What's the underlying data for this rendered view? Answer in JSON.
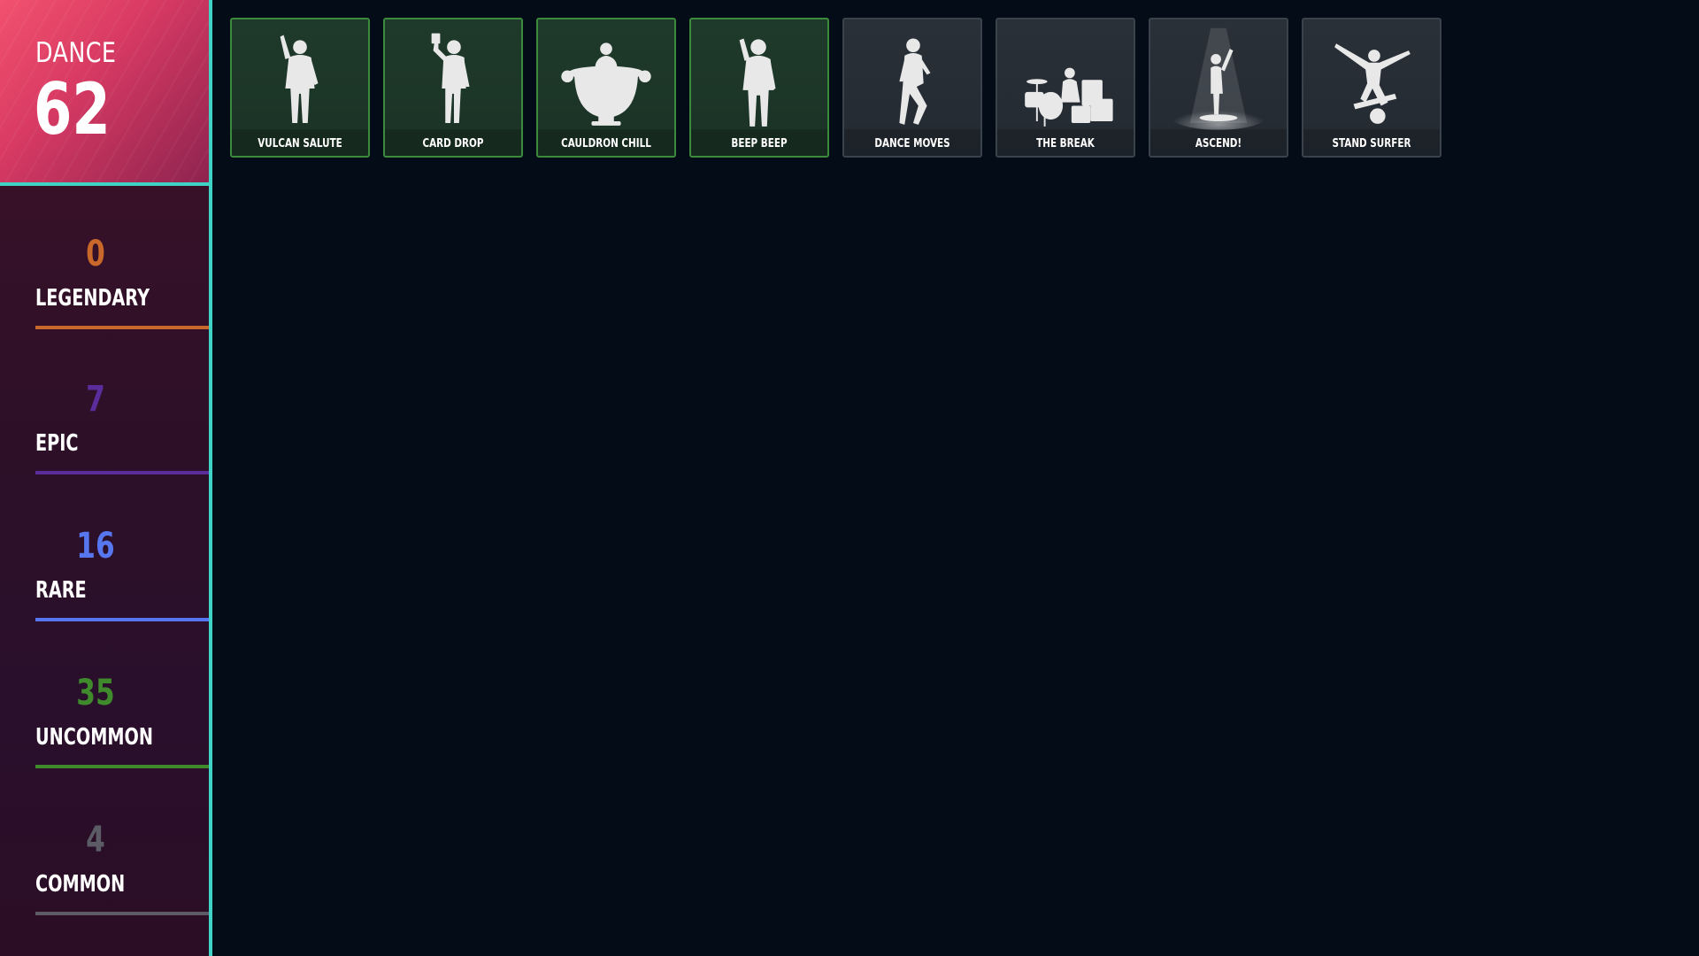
{
  "locker": {
    "category_label": "DANCE",
    "total_count": "62"
  },
  "rarities": [
    {
      "count": "0",
      "label": "LEGENDARY",
      "color": "#c8682a"
    },
    {
      "count": "7",
      "label": "EPIC",
      "color": "#5b2d9c"
    },
    {
      "count": "16",
      "label": "RARE",
      "color": "#5677f0"
    },
    {
      "count": "35",
      "label": "UNCOMMON",
      "color": "#3f8b2c"
    },
    {
      "count": "4",
      "label": "COMMON",
      "color": "#5c5c66"
    }
  ],
  "emotes": [
    {
      "name": "VULCAN SALUTE",
      "rarity": "uncommon",
      "icon": "salute-silhouette-icon"
    },
    {
      "name": "CARD DROP",
      "rarity": "uncommon",
      "icon": "card-drop-silhouette-icon"
    },
    {
      "name": "CAULDRON CHILL",
      "rarity": "uncommon",
      "icon": "cauldron-silhouette-icon"
    },
    {
      "name": "BEEP BEEP",
      "rarity": "uncommon",
      "icon": "beep-beep-silhouette-icon"
    },
    {
      "name": "DANCE MOVES",
      "rarity": "common",
      "icon": "dance-moves-silhouette-icon"
    },
    {
      "name": "THE BREAK",
      "rarity": "common",
      "icon": "drums-silhouette-icon"
    },
    {
      "name": "ASCEND!",
      "rarity": "common",
      "icon": "spotlight-silhouette-icon"
    },
    {
      "name": "STAND SURFER",
      "rarity": "common",
      "icon": "surfer-silhouette-icon"
    }
  ]
}
